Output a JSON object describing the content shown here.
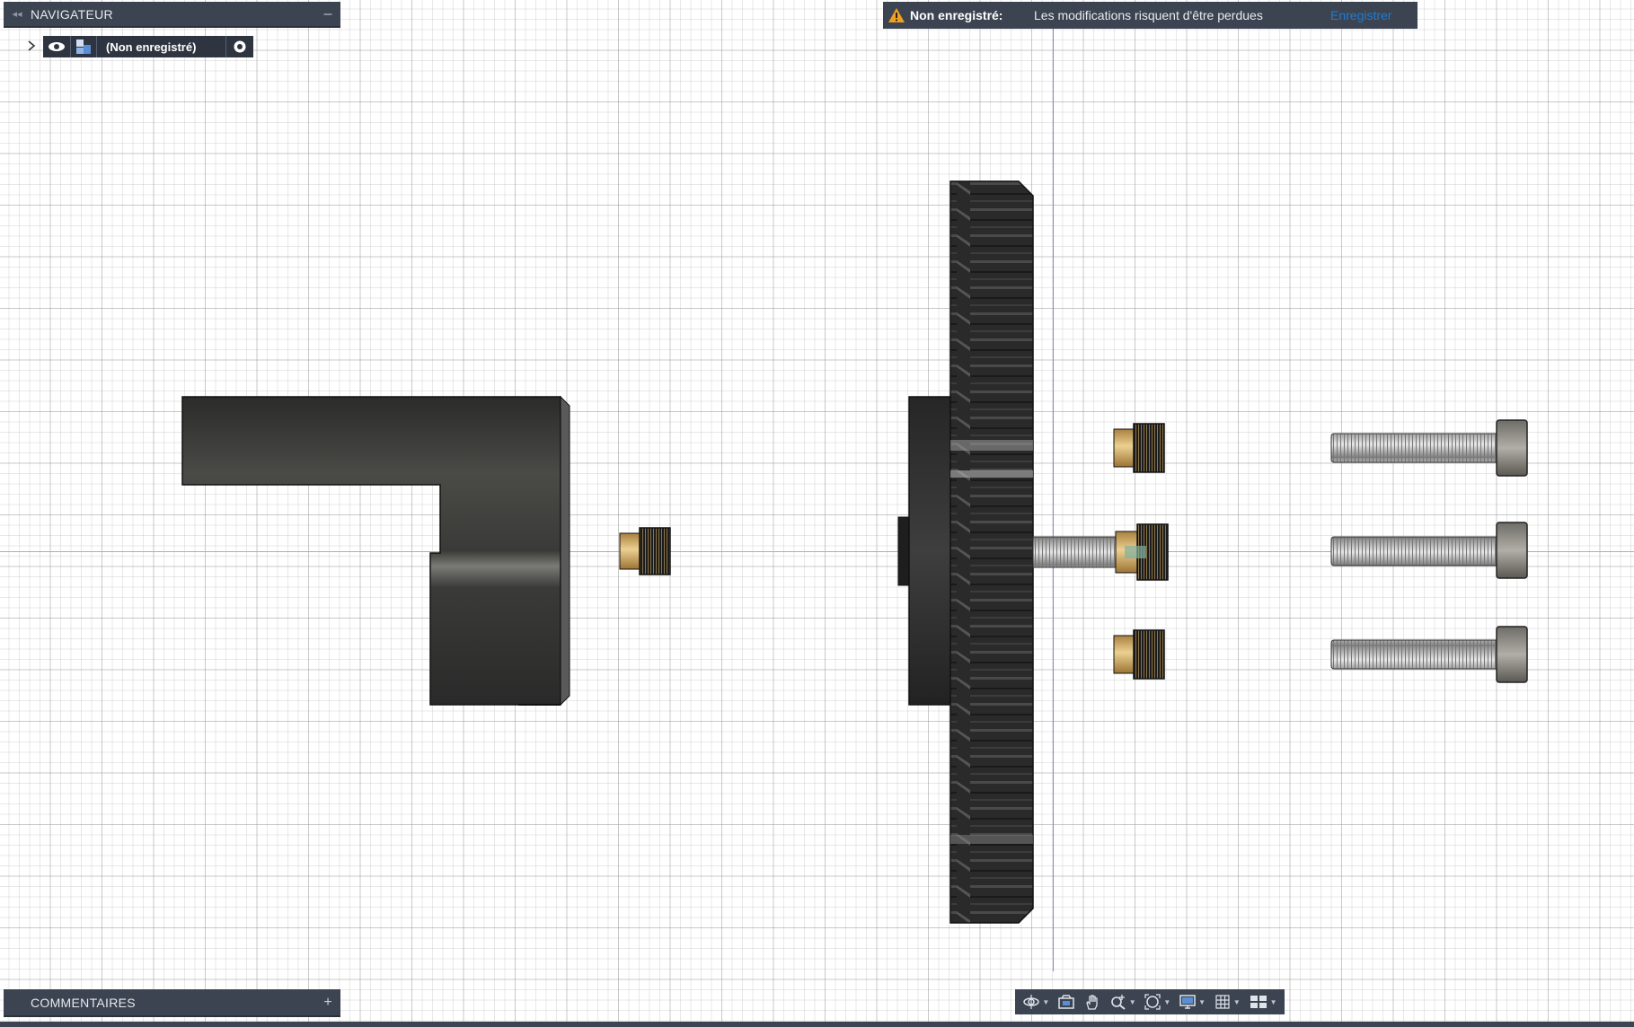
{
  "navigator": {
    "title": "NAVIGATEUR",
    "collapse_icon": "double-chevron-left-icon",
    "minimize_symbol": "–",
    "root_item": {
      "label": "(Non enregistré)"
    }
  },
  "banner": {
    "label": "Non enregistré:",
    "message": "Les modifications risquent d'être perdues",
    "save_link": "Enregistrer",
    "warning_color": "#f0a020"
  },
  "comments": {
    "title": "COMMENTAIRES",
    "add_symbol": "+"
  },
  "toolbar": {
    "tools": [
      "orbit-icon",
      "look-at-icon",
      "pan-icon",
      "zoom-icon",
      "fit-icon",
      "display-settings-icon",
      "grid-icon",
      "viewports-icon"
    ]
  },
  "colors": {
    "panel": "#3c4452",
    "part_dark": "#3a3a3a",
    "brass": "#c9a25e",
    "link": "#1f7bd0"
  }
}
